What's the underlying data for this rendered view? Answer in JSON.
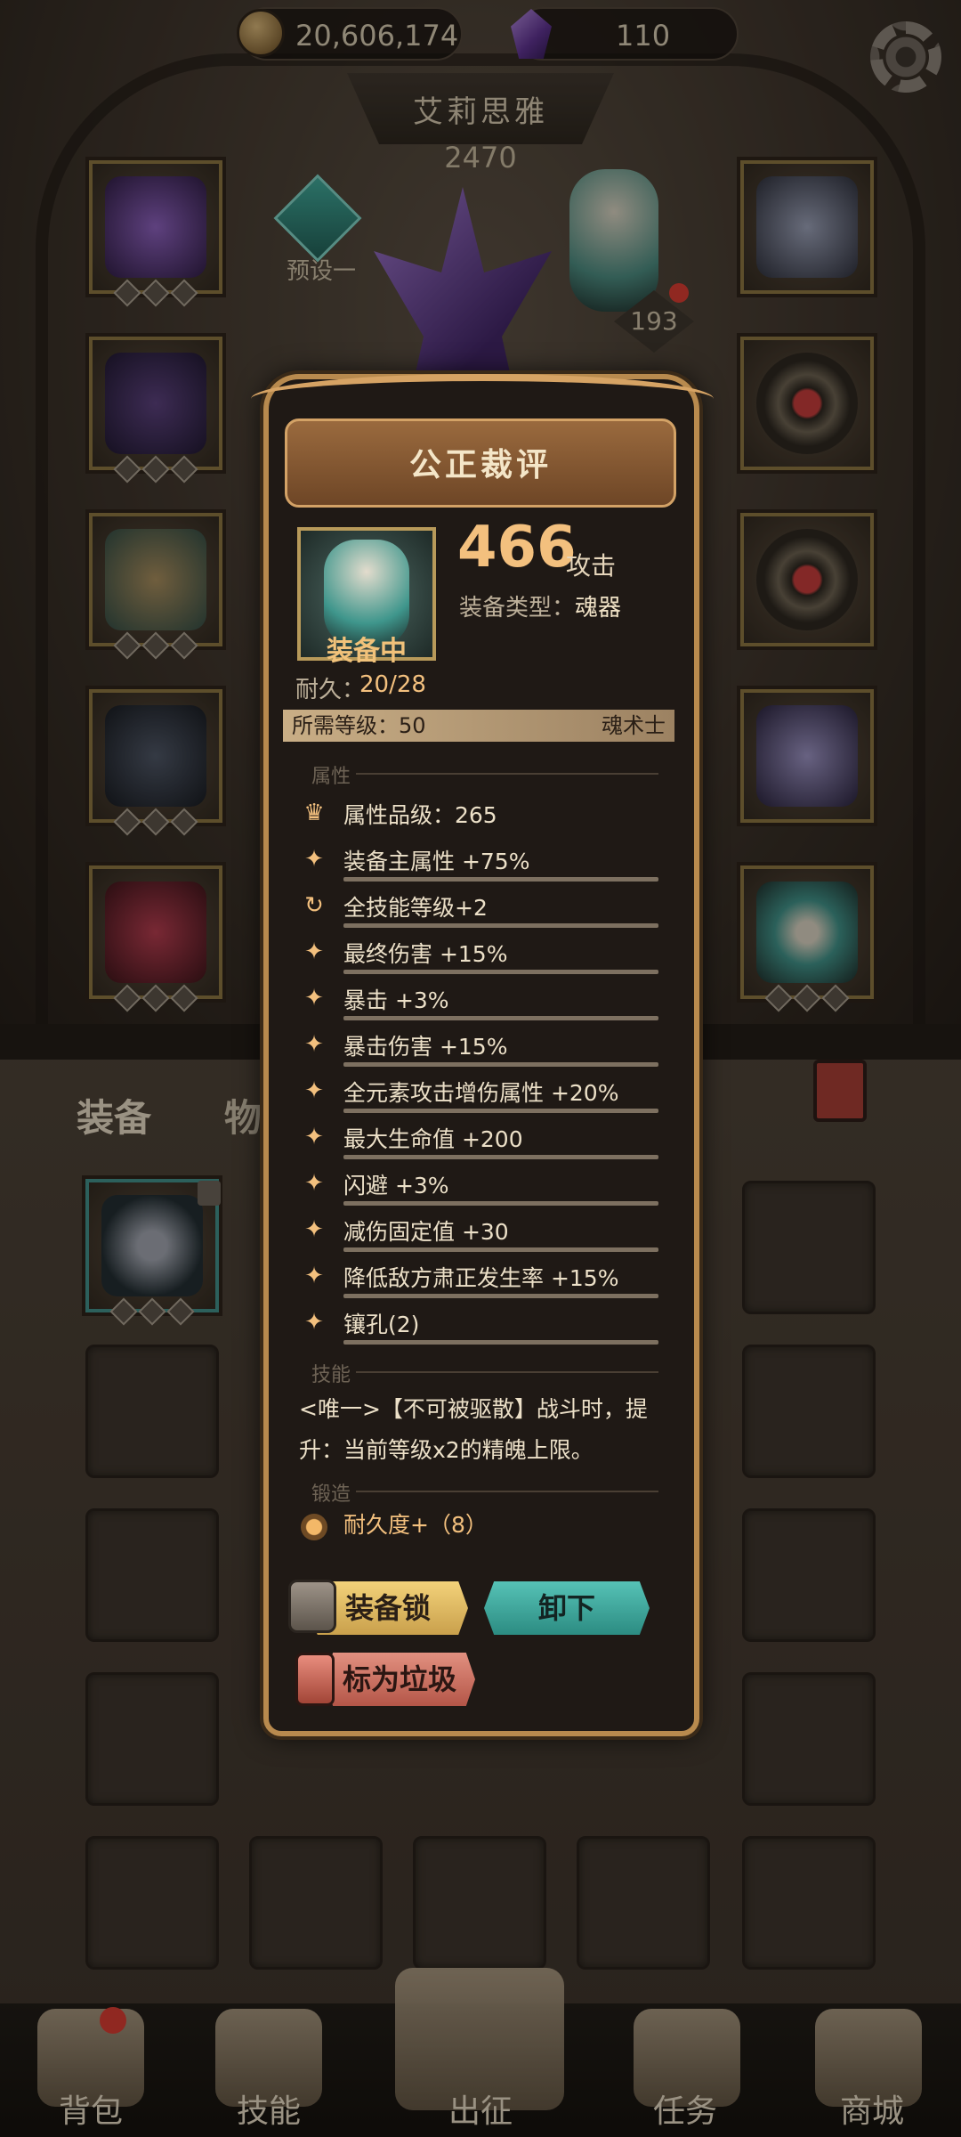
{
  "currency": {
    "gold": "20,606,174",
    "gems": "110"
  },
  "character": {
    "name": "艾莉思雅",
    "power": "2470"
  },
  "preset": {
    "label": "预设一"
  },
  "soul_counter": "193",
  "bag_tabs": [
    "装备",
    "物品"
  ],
  "popup": {
    "title": "公正裁评",
    "attack_value": "466",
    "attack_unit": "攻击",
    "equip_type_label": "装备类型：",
    "equip_type_value": "魂器",
    "equipped_label": "装备中",
    "durability_label": "耐久：",
    "durability_value": "20/28",
    "required_level_label": "所需等级：50",
    "class_name": "魂术士",
    "section_attributes": "属性",
    "stats": [
      {
        "icon": "crown-icon",
        "text": "属性品级：265"
      },
      {
        "icon": "star-icon",
        "text": "装备主属性 +75%"
      },
      {
        "icon": "cycle-icon",
        "text": "全技能等级+2"
      },
      {
        "icon": "star-icon",
        "text": "最终伤害 +15%"
      },
      {
        "icon": "star-icon",
        "text": "暴击 +3%"
      },
      {
        "icon": "star-icon",
        "text": "暴击伤害 +15%"
      },
      {
        "icon": "star-icon",
        "text": "全元素攻击增伤属性 +20%"
      },
      {
        "icon": "star-icon",
        "text": "最大生命值 +200"
      },
      {
        "icon": "star-icon",
        "text": "闪避 +3%"
      },
      {
        "icon": "star-icon",
        "text": "减伤固定值 +30"
      },
      {
        "icon": "star-icon",
        "text": "降低敌方肃正发生率 +15%"
      },
      {
        "icon": "star-icon",
        "text": "镶孔(2)"
      }
    ],
    "section_skills": "技能",
    "skill_line1": "<唯一>【不可被驱散】战斗时，提",
    "skill_line2": "升：当前等级x2的精魄上限。",
    "section_forge": "锻造",
    "forge_item": "耐久度+（8）",
    "buttons": {
      "lock": "装备锁",
      "unequip": "卸下",
      "junk": "标为垃圾"
    }
  },
  "nav": [
    {
      "label": "背包",
      "name": "nav-bag"
    },
    {
      "label": "技能",
      "name": "nav-skills"
    },
    {
      "label": "出征",
      "name": "nav-expedition"
    },
    {
      "label": "任务",
      "name": "nav-quests"
    },
    {
      "label": "商城",
      "name": "nav-shop"
    }
  ],
  "colors": {
    "accent_gold": "#f3c07e",
    "popup_border": "#b88a4e",
    "unequip_teal": "#2c8c82",
    "junk_red": "#b45648"
  }
}
